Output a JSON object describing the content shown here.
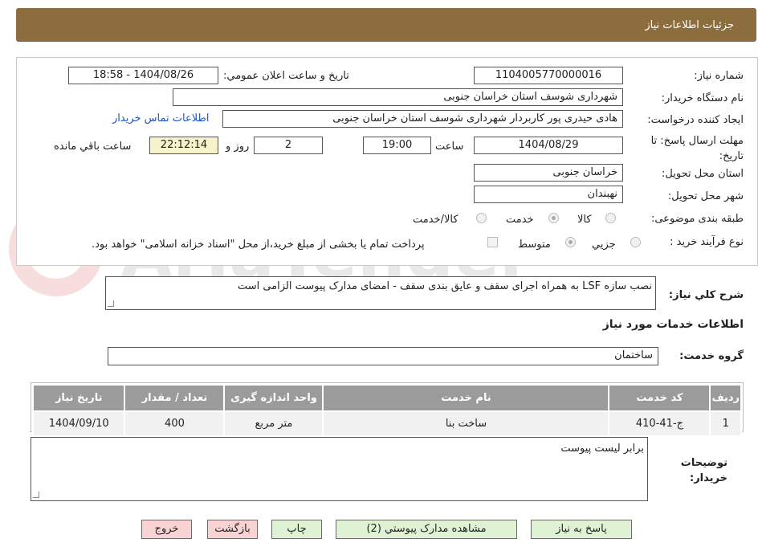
{
  "header": {
    "title": "جزئیات اطلاعات نیاز"
  },
  "fields": {
    "need_number_label": "شماره نیاز:",
    "need_number": "1104005770000016",
    "announce_label": "تاریخ و ساعت اعلان عمومي:",
    "announce_value": "1404/08/26 - 18:58",
    "buyer_org_label": "نام دستگاه خریدار:",
    "buyer_org": "شهرداری شوسف استان خراسان جنوبی",
    "creator_label": "ایجاد کننده درخواست:",
    "creator": "هادی حیدری پور کاربردار شهرداری شوسف استان خراسان جنوبی",
    "contact_link": "اطلاعات تماس خریدار",
    "deadline_label": "مهلت ارسال پاسخ: تا تاریخ:",
    "deadline_date": "1404/08/29",
    "hour_label": "ساعت",
    "deadline_time": "19:00",
    "days_value": "2",
    "days_label": "روز و",
    "remaining_time": "22:12:14",
    "remaining_label": "ساعت باقي مانده",
    "province_label": "استان محل تحویل:",
    "province": "خراسان جنوبی",
    "city_label": "شهر محل تحویل:",
    "city": "نهبندان",
    "category_label": "طبقه بندی موضوعی:",
    "category_options": [
      "کالا",
      "خدمت",
      "کالا/خدمت"
    ],
    "category_selected": "خدمت",
    "process_label": "نوع فرآیند خرید :",
    "process_options": [
      "جزيي",
      "متوسط"
    ],
    "process_selected": "متوسط",
    "payment_note": "پرداخت تمام یا بخشی از مبلغ خرید،از محل \"اسناد خزانه اسلامی\" خواهد بود."
  },
  "description": {
    "label": "شرح کلي نياز:",
    "value": "نصب سازه LSF به همراه اجرای سقف و عایق بندی سقف - امضای مدارک پیوست الزامی است"
  },
  "services": {
    "section_title": "اطلاعات خدمات مورد نياز",
    "group_label": "گروه خدمت:",
    "group_value": "ساختمان",
    "columns": [
      "رديف",
      "کد خدمت",
      "نام خدمت",
      "واحد اندازه گیری",
      "تعداد / مقدار",
      "تاریخ نیاز"
    ],
    "rows": [
      [
        "1",
        "ج-41-410",
        "ساخت بنا",
        "متر مربع",
        "400",
        "1404/09/10"
      ]
    ]
  },
  "buyer_notes": {
    "label": "توضيحات خريدار:",
    "value": "برابر لیست پیوست"
  },
  "buttons": {
    "reply": "پاسخ به نیاز",
    "attachments": "مشاهده مدارک پيوستي (2)",
    "print": "چاپ",
    "back": "بازگشت",
    "exit": "خروج"
  },
  "watermark": "AriaTender.neT",
  "colors": {
    "header_bg": "#8c6d3e",
    "table_header_bg": "#9b9b9b",
    "button_green": "#dff3d4",
    "button_pink": "#f9d3d3",
    "link": "#1a55c9"
  }
}
